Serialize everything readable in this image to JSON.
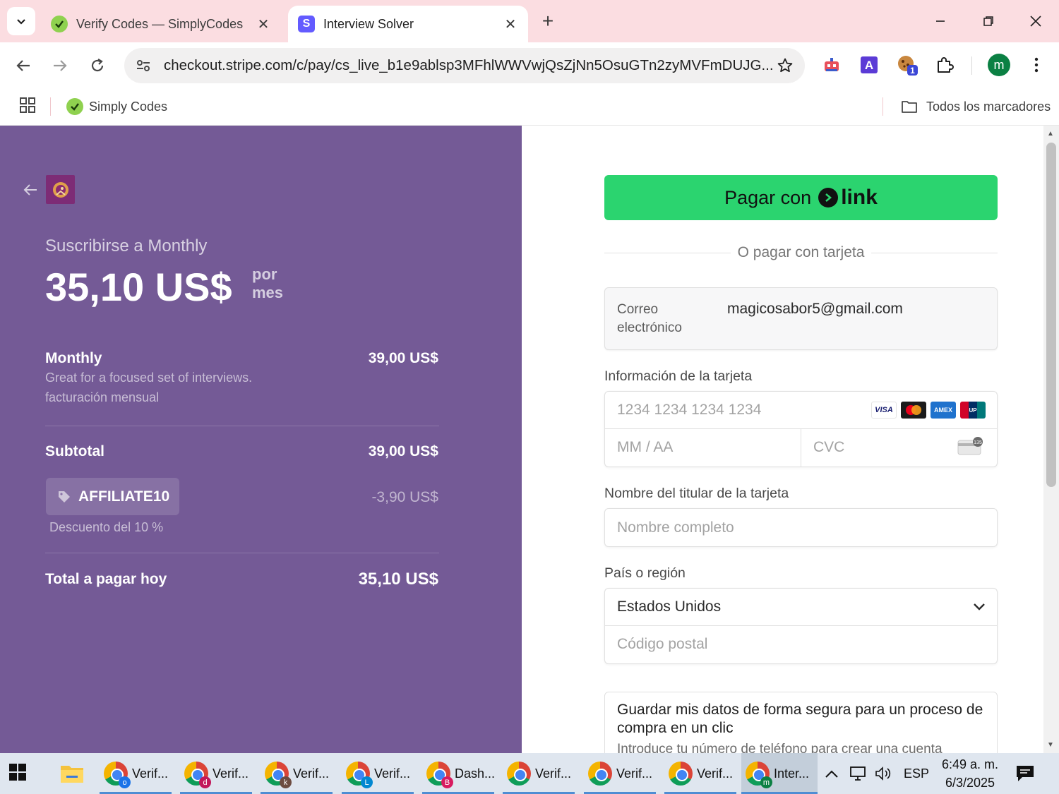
{
  "browser": {
    "tabs": [
      {
        "title": "Verify Codes — SimplyCodes",
        "active": false
      },
      {
        "title": "Interview Solver",
        "active": true
      }
    ],
    "url": "checkout.stripe.com/c/pay/cs_live_b1e9ablsp3MFhlWWVwjQsZjNn5OsuGTn2zyMVFmDUJG...",
    "profile_initial": "m",
    "extension_badge": "1",
    "bookmarks": [
      {
        "label": "Simply Codes"
      }
    ],
    "all_bookmarks_label": "Todos los marcadores"
  },
  "summary": {
    "subscribe_title": "Suscribirse a Monthly",
    "price": "35,10 US$",
    "period_line1": "por",
    "period_line2": "mes",
    "item": {
      "name": "Monthly",
      "description": "Great for a focused set of interviews.",
      "billing": "facturación mensual",
      "amount": "39,00 US$"
    },
    "subtotal_label": "Subtotal",
    "subtotal_amount": "39,00 US$",
    "promo_code": "AFFILIATE10",
    "promo_description": "Descuento del 10 %",
    "discount_amount": "-3,90 US$",
    "total_label": "Total a pagar hoy",
    "total_amount": "35,10 US$"
  },
  "payment": {
    "link_button_prefix": "Pagar con",
    "link_button_word": "link",
    "divider_text": "O pagar con tarjeta",
    "email_label": "Correo electrónico",
    "email_value": "magicosabor5@gmail.com",
    "card_section_label": "Información de la tarjeta",
    "card_number_placeholder": "1234 1234 1234 1234",
    "expiry_placeholder": "MM / AA",
    "cvc_placeholder": "CVC",
    "card_brands": [
      "VISA",
      "Mastercard",
      "American Express",
      "UnionPay"
    ],
    "cardholder_label": "Nombre del titular de la tarjeta",
    "cardholder_placeholder": "Nombre completo",
    "country_label": "País o región",
    "country_value": "Estados Unidos",
    "postal_placeholder": "Código postal",
    "save_title": "Guardar mis datos de forma segura para un proceso de compra en un clic",
    "save_desc": "Introduce tu número de teléfono para crear una cuenta"
  },
  "taskbar": {
    "items": [
      {
        "label": "Verif...",
        "badge": "o",
        "badge_color": "#1a73e8"
      },
      {
        "label": "Verif...",
        "badge": "d",
        "badge_color": "#c2185b"
      },
      {
        "label": "Verif...",
        "badge": "k",
        "badge_color": "#6d4c41"
      },
      {
        "label": "Verif...",
        "badge": "L",
        "badge_color": "#0288d1"
      },
      {
        "label": "Dash...",
        "badge": "B",
        "badge_color": "#d81b60"
      },
      {
        "label": "Verif...",
        "badge": "",
        "badge_color": ""
      },
      {
        "label": "Verif...",
        "badge": "",
        "badge_color": ""
      },
      {
        "label": "Verif...",
        "badge": "",
        "badge_color": ""
      },
      {
        "label": "Inter...",
        "badge": "m",
        "badge_color": "#0b8043"
      }
    ],
    "language": "ESP",
    "time": "6:49 a. m.",
    "date": "6/3/2025"
  },
  "colors": {
    "summary_bg": "#745a96",
    "link_green": "#2bd46f",
    "tab_strip": "#fbdde1"
  }
}
